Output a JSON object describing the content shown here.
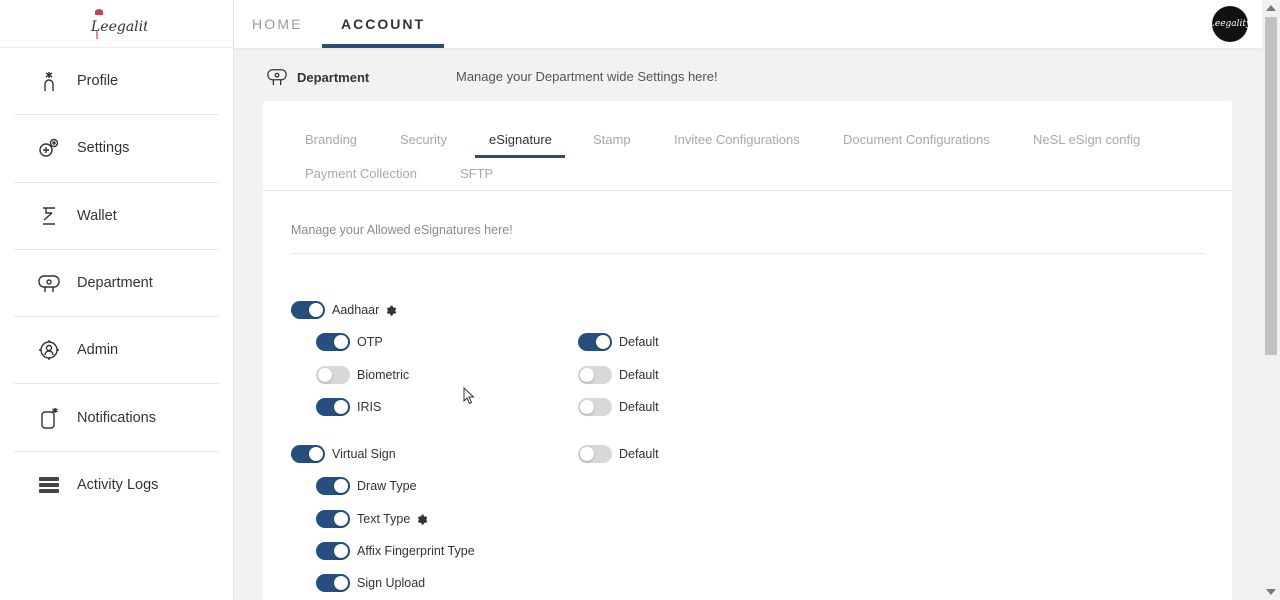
{
  "brand": {
    "logo_text": "Leegality"
  },
  "topnav": {
    "home": "HOME",
    "account": "ACCOUNT",
    "avatar_text": "Leegality"
  },
  "sidebar": {
    "items": [
      {
        "label": "Profile",
        "icon": "profile-icon"
      },
      {
        "label": "Settings",
        "icon": "settings-icon"
      },
      {
        "label": "Wallet",
        "icon": "wallet-icon"
      },
      {
        "label": "Department",
        "icon": "department-icon"
      },
      {
        "label": "Admin",
        "icon": "admin-icon"
      },
      {
        "label": "Notifications",
        "icon": "notifications-icon"
      },
      {
        "label": "Activity Logs",
        "icon": "activity-logs-icon"
      }
    ]
  },
  "department": {
    "title": "Department",
    "subtitle": "Manage your Department wide Settings here!"
  },
  "tabs": [
    "Branding",
    "Security",
    "eSignature",
    "Stamp",
    "Invitee Configurations",
    "Document Configurations",
    "NeSL eSign config",
    "Payment Collection",
    "SFTP"
  ],
  "active_tab": "eSignature",
  "esign": {
    "description": "Manage your Allowed eSignatures here!",
    "aadhaar": {
      "label": "Aadhaar",
      "enabled": true
    },
    "otp": {
      "label": "OTP",
      "enabled": true,
      "default_label": "Default",
      "default": true
    },
    "biometric": {
      "label": "Biometric",
      "enabled": false,
      "default_label": "Default",
      "default": false
    },
    "iris": {
      "label": "IRIS",
      "enabled": true,
      "default_label": "Default",
      "default": false
    },
    "virtual_sign": {
      "label": "Virtual Sign",
      "enabled": true,
      "default_label": "Default",
      "default": false
    },
    "draw_type": {
      "label": "Draw Type",
      "enabled": true
    },
    "text_type": {
      "label": "Text Type",
      "enabled": true
    },
    "affix_fingerprint": {
      "label": "Affix Fingerprint Type",
      "enabled": true
    },
    "sign_upload": {
      "label": "Sign Upload",
      "enabled": true
    }
  },
  "colors": {
    "accent": "#274f7e",
    "toggle_off": "#d8d8d8"
  }
}
